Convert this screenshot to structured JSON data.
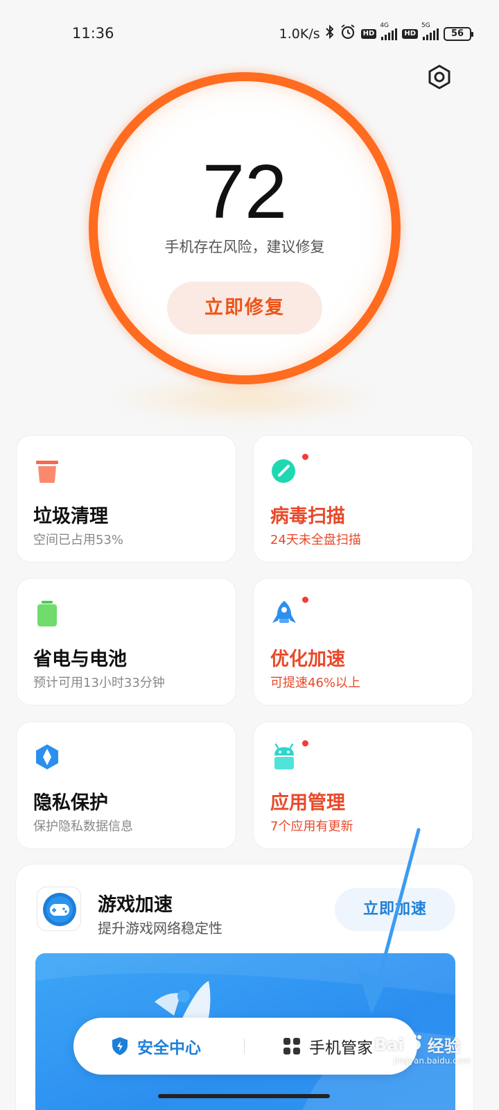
{
  "status_bar": {
    "time": "11:36",
    "net_speed": "1.0K/s",
    "sim1_tag": "4G",
    "sim2_tag": "5G",
    "hd_label": "HD",
    "battery": "56"
  },
  "score": {
    "value": "72",
    "status_text": "手机存在风险，建议修复",
    "fix_button": "立即修复",
    "ring_color": "#ff6b1f"
  },
  "cards": [
    {
      "title": "垃圾清理",
      "subtitle": "空间已占用53%",
      "icon": "trash-icon",
      "alert": false
    },
    {
      "title": "病毒扫描",
      "subtitle": "24天未全盘扫描",
      "icon": "virus-scan-icon",
      "alert": true
    },
    {
      "title": "省电与电池",
      "subtitle": "预计可用13小时33分钟",
      "icon": "battery-icon",
      "alert": false
    },
    {
      "title": "优化加速",
      "subtitle": "可提速46%以上",
      "icon": "rocket-icon",
      "alert": true
    },
    {
      "title": "隐私保护",
      "subtitle": "保护隐私数据信息",
      "icon": "privacy-shield-icon",
      "alert": false
    },
    {
      "title": "应用管理",
      "subtitle": "7个应用有更新",
      "icon": "android-icon",
      "alert": true
    }
  ],
  "game_boost": {
    "title": "游戏加速",
    "subtitle": "提升游戏网络稳定性",
    "button": "立即加速"
  },
  "bottom_nav": {
    "security_center": "安全中心",
    "phone_manager": "手机管家"
  },
  "watermark": {
    "brand": "Bai",
    "brand_suffix": "经验",
    "url": "jingyan.baidu.com"
  },
  "colors": {
    "alert_text": "#e8492a",
    "accent_blue": "#1e7fd9",
    "ring_orange": "#ff6b1f"
  }
}
